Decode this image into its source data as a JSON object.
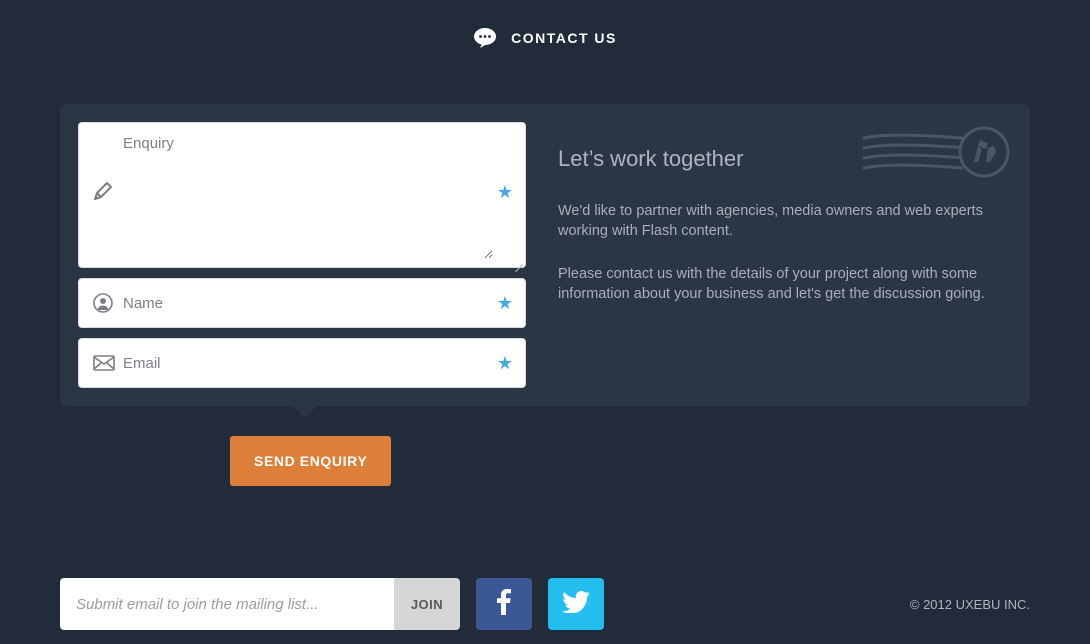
{
  "header": {
    "title": "CONTACT US"
  },
  "form": {
    "enquiry_placeholder": "Enquiry",
    "name_placeholder": "Name",
    "email_placeholder": "Email",
    "submit_label": "SEND ENQUIRY"
  },
  "copy": {
    "title": "Let’s work together",
    "p1": "We'd like to partner with agencies, media owners and web experts working with Flash content.",
    "p2": "Please contact us with the details of your project along with some information about your business and let's get the discussion going."
  },
  "footer": {
    "mailing_placeholder": "Submit email to join the mailing list...",
    "join_label": "JOIN",
    "copyright": "© 2012 UXEBU INC."
  },
  "colors": {
    "accent_orange": "#dd7f38",
    "accent_blue": "#47a9e6",
    "panel": "#2b3645",
    "bg": "#222b39",
    "facebook": "#3b5796",
    "twitter": "#24bdf0"
  }
}
